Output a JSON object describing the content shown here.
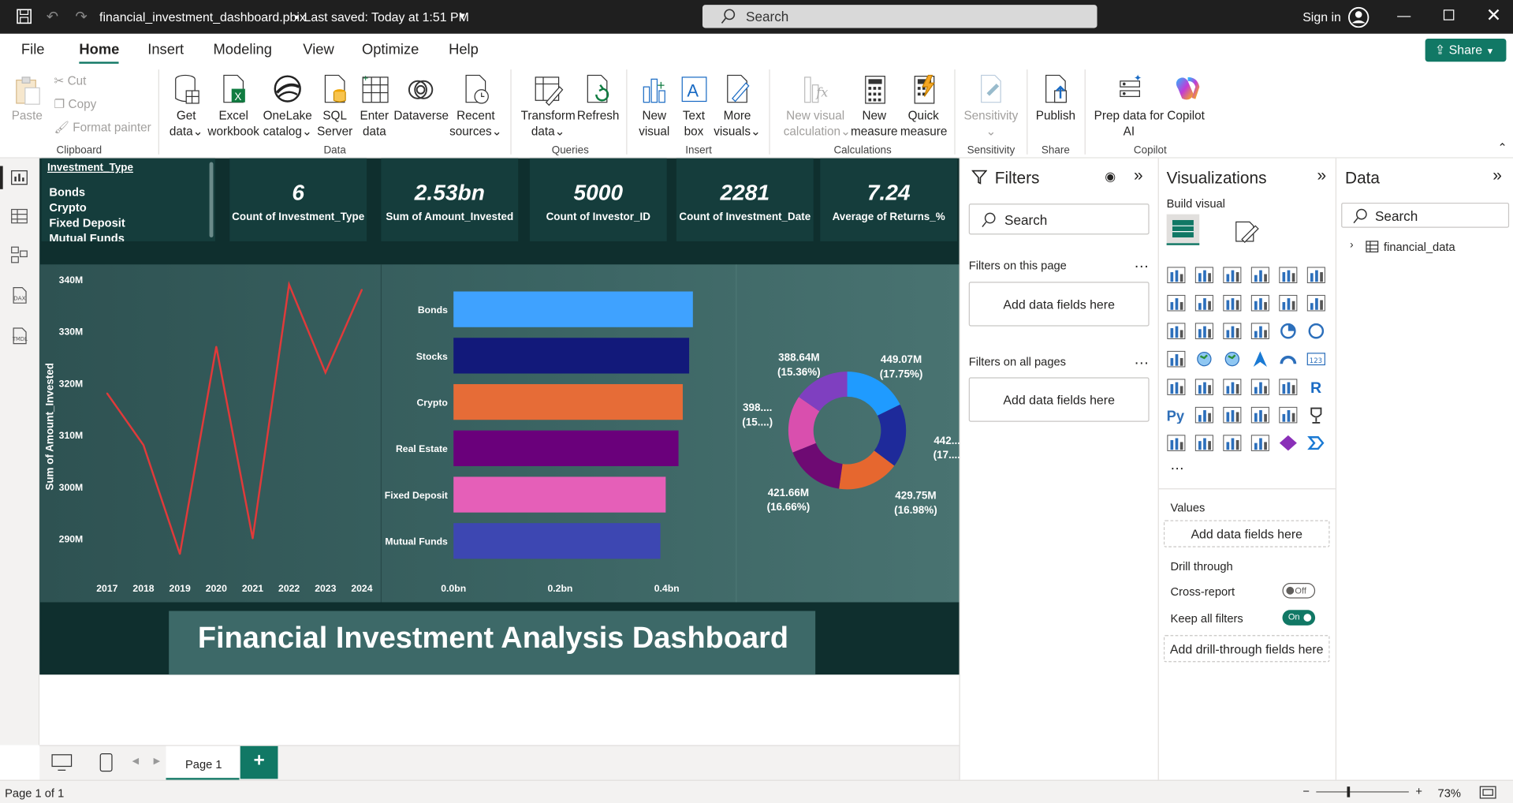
{
  "titlebar": {
    "filename": "financial_investment_dashboard.pbix",
    "saved": "Last saved: Today at 1:51 PM",
    "search": "Search",
    "signin": "Sign in"
  },
  "menu": {
    "items": [
      "File",
      "Home",
      "Insert",
      "Modeling",
      "View",
      "Optimize",
      "Help"
    ],
    "share": "Share"
  },
  "ribbon": {
    "clipboard": {
      "paste": "Paste",
      "cut": "Cut",
      "copy": "Copy",
      "format_painter": "Format painter",
      "group": "Clipboard"
    },
    "data": {
      "get_data": [
        "Get",
        "data"
      ],
      "excel": [
        "Excel",
        "workbook"
      ],
      "onelake": [
        "OneLake",
        "catalog"
      ],
      "sql": [
        "SQL",
        "Server"
      ],
      "enter": [
        "Enter",
        "data"
      ],
      "dataverse": "Dataverse",
      "recent": [
        "Recent",
        "sources"
      ],
      "group": "Data"
    },
    "queries": {
      "transform": [
        "Transform",
        "data"
      ],
      "refresh": "Refresh",
      "group": "Queries"
    },
    "insert": {
      "new_visual": [
        "New",
        "visual"
      ],
      "text_box": [
        "Text",
        "box"
      ],
      "more": [
        "More",
        "visuals"
      ],
      "group": "Insert"
    },
    "calculations": {
      "new_visual_calc": [
        "New visual",
        "calculation"
      ],
      "new_measure": [
        "New",
        "measure"
      ],
      "quick_measure": [
        "Quick",
        "measure"
      ],
      "group": "Calculations"
    },
    "sensitivity": {
      "label": "Sensitivity",
      "group": "Sensitivity"
    },
    "share": {
      "publish": "Publish",
      "group": "Share"
    },
    "copilot": {
      "prep": [
        "Prep data for",
        "AI"
      ],
      "copilot": "Copilot",
      "group": "Copilot"
    }
  },
  "report": {
    "slicer": {
      "title": "Investment_Type",
      "items": [
        "Bonds",
        "Crypto",
        "Fixed Deposit",
        "Mutual Funds"
      ]
    },
    "cards": [
      {
        "value": "6",
        "label": "Count of Investment_Type"
      },
      {
        "value": "2.53bn",
        "label": "Sum of Amount_Invested"
      },
      {
        "value": "5000",
        "label": "Count of Investor_ID"
      },
      {
        "value": "2281",
        "label": "Count of Investment_Date"
      },
      {
        "value": "7.24",
        "label": "Average of Returns_%"
      }
    ],
    "banner": "Financial Investment Analysis Dashboard"
  },
  "chart_data": [
    {
      "type": "line",
      "title": "",
      "xlabel": "",
      "ylabel": "Sum of Amount_Invested",
      "x": [
        "2017",
        "2018",
        "2019",
        "2020",
        "2021",
        "2022",
        "2023",
        "2024"
      ],
      "yticks": [
        "340M",
        "330M",
        "320M",
        "310M",
        "300M",
        "290M"
      ],
      "ylim": [
        287,
        341
      ],
      "series": [
        {
          "values": [
            318,
            308,
            287,
            327,
            290,
            339,
            322,
            338
          ],
          "color": "#e03a3a"
        }
      ]
    },
    {
      "type": "bar",
      "orientation": "horizontal",
      "categories": [
        "Bonds",
        "Stocks",
        "Crypto",
        "Real Estate",
        "Fixed Deposit",
        "Mutual Funds"
      ],
      "values": [
        0.449,
        0.442,
        0.43,
        0.422,
        0.398,
        0.388
      ],
      "colors": [
        "#3fa2ff",
        "#12197a",
        "#e66c37",
        "#6a007b",
        "#e55fb8",
        "#3d47b2"
      ],
      "xticks": [
        "0.0bn",
        "0.2bn",
        "0.4bn"
      ],
      "xlim": [
        0,
        0.4
      ]
    },
    {
      "type": "pie",
      "style": "donut",
      "slices": [
        {
          "value": 449.07,
          "label": [
            "449.07M",
            "(17.75%)"
          ],
          "color": "#1f9bff"
        },
        {
          "value": 442.0,
          "label": [
            "442....",
            "(17....)"
          ],
          "color": "#1e2a9a"
        },
        {
          "value": 429.75,
          "label": [
            "429.75M",
            "(16.98%)"
          ],
          "color": "#e6672f"
        },
        {
          "value": 421.66,
          "label": [
            "421.66M",
            "(16.66%)"
          ],
          "color": "#6e0a73"
        },
        {
          "value": 398.0,
          "label": [
            "398....",
            "(15....)"
          ],
          "color": "#d94fae"
        },
        {
          "value": 388.64,
          "label": [
            "388.64M",
            "(15.36%)"
          ],
          "color": "#7f3fc0"
        }
      ]
    }
  ],
  "filters": {
    "title": "Filters",
    "search": "Search",
    "page_label": "Filters on this page",
    "all_label": "Filters on all pages",
    "add": "Add data fields here"
  },
  "visualizations": {
    "title": "Visualizations",
    "build": "Build visual",
    "values": "Values",
    "add": "Add data fields here",
    "drill": "Drill through",
    "cross": "Cross-report",
    "cross_state": "Off",
    "keep": "Keep all filters",
    "keep_state": "On",
    "add_drill": "Add drill-through fields here"
  },
  "data_pane": {
    "title": "Data",
    "search": "Search",
    "table": "financial_data"
  },
  "tabs": {
    "page": "Page 1",
    "plus": "+"
  },
  "status": {
    "page": "Page 1 of 1",
    "zoom": "73%"
  }
}
